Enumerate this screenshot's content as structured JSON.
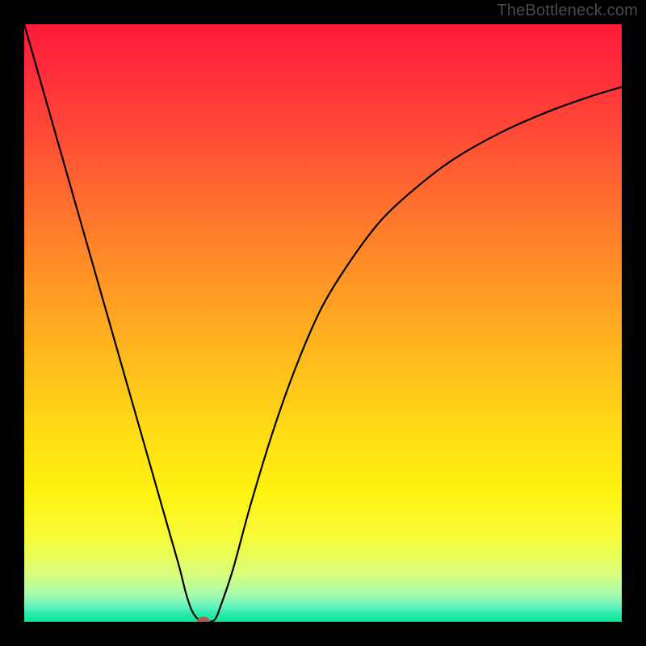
{
  "watermark": "TheBottleneck.com",
  "chart_data": {
    "type": "line",
    "title": "",
    "xlabel": "",
    "ylabel": "",
    "xlim": [
      0,
      100
    ],
    "ylim": [
      0,
      100
    ],
    "background_gradient": {
      "stops": [
        {
          "offset": 0.0,
          "color": "#ff1a3a"
        },
        {
          "offset": 0.08,
          "color": "#ff2d3b"
        },
        {
          "offset": 0.18,
          "color": "#ff4a36"
        },
        {
          "offset": 0.3,
          "color": "#ff6f2e"
        },
        {
          "offset": 0.42,
          "color": "#ff9326"
        },
        {
          "offset": 0.55,
          "color": "#ffb81e"
        },
        {
          "offset": 0.67,
          "color": "#ffd916"
        },
        {
          "offset": 0.78,
          "color": "#fff210"
        },
        {
          "offset": 0.86,
          "color": "#f6fb3a"
        },
        {
          "offset": 0.92,
          "color": "#d8fd7a"
        },
        {
          "offset": 0.955,
          "color": "#a6fbb0"
        },
        {
          "offset": 0.975,
          "color": "#60f3c0"
        },
        {
          "offset": 0.99,
          "color": "#1ee9a8"
        },
        {
          "offset": 1.0,
          "color": "#0fe79e"
        }
      ]
    },
    "series": [
      {
        "name": "bottleneck-curve",
        "x": [
          0,
          4,
          8,
          12,
          16,
          20,
          22,
          24,
          26,
          27,
          28,
          29,
          30,
          31,
          32,
          33,
          35,
          38,
          42,
          46,
          50,
          55,
          60,
          66,
          72,
          80,
          88,
          95,
          100
        ],
        "y": [
          100,
          86,
          72,
          58,
          44,
          30,
          23,
          16,
          9,
          5,
          2,
          0.5,
          0,
          0,
          0.5,
          3,
          9,
          20,
          33,
          44,
          53,
          61,
          67.5,
          73,
          77.5,
          82,
          85.5,
          88,
          89.5
        ]
      }
    ],
    "marker": {
      "name": "curve-minimum",
      "x": 30,
      "y": 0,
      "rx": 1.1,
      "ry": 0.85,
      "color": "#b55a4a"
    }
  }
}
